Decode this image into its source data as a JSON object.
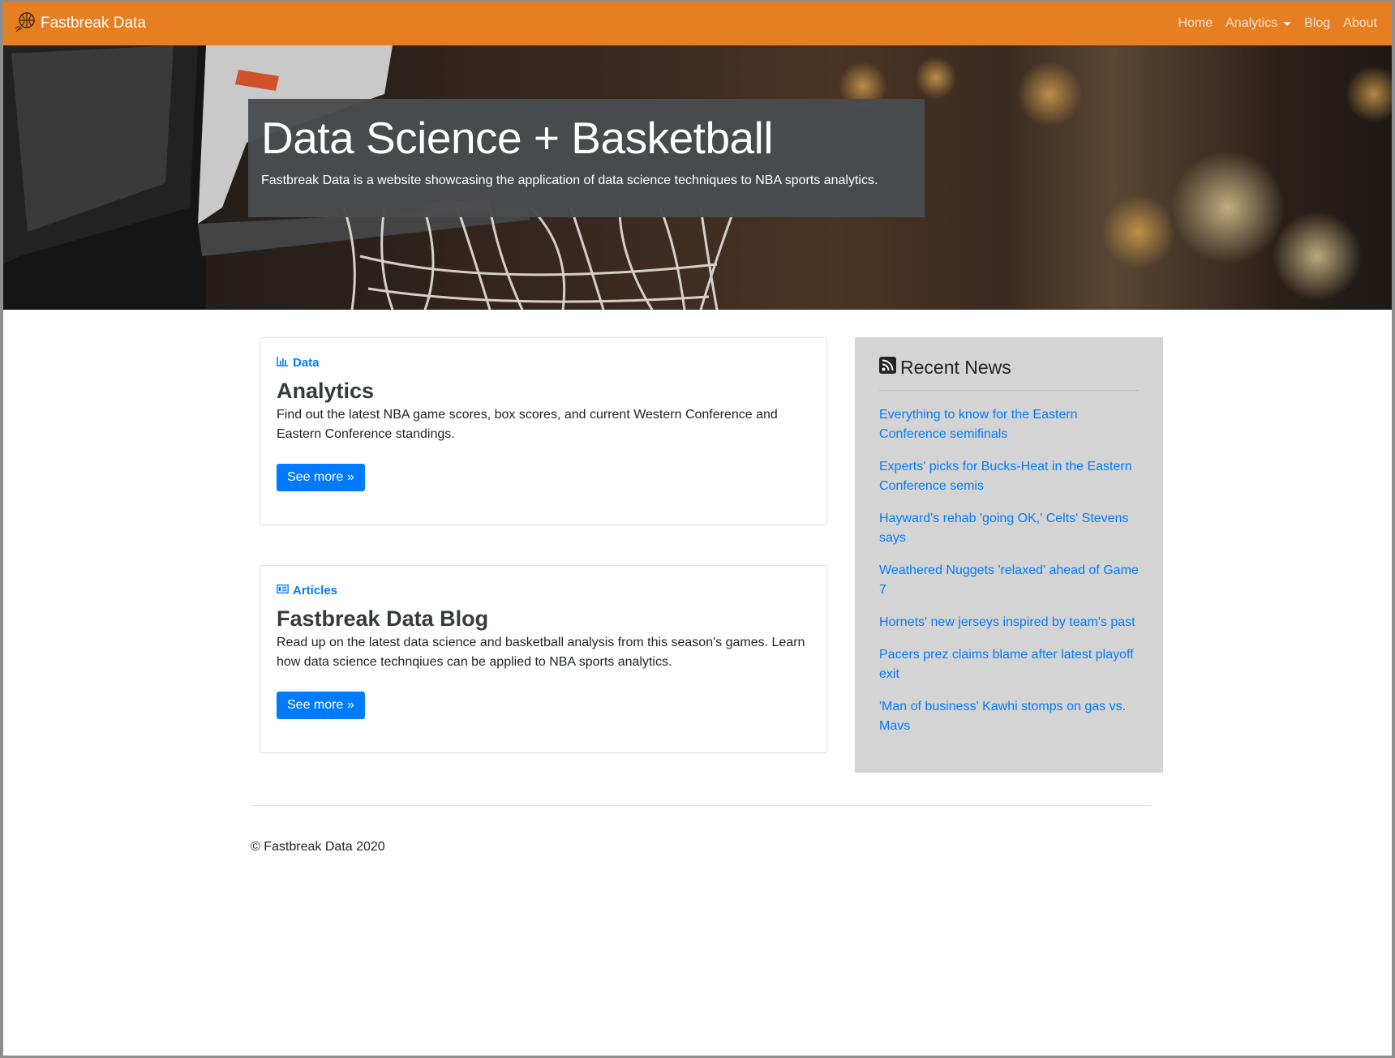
{
  "navbar": {
    "brand": "Fastbreak Data",
    "links": [
      "Home",
      "Analytics",
      "Blog",
      "About"
    ],
    "color": "#e67e22"
  },
  "hero": {
    "title": "Data Science + Basketball",
    "subtitle": "Fastbreak Data is a website showcasing the application of data science techniques to NBA sports analytics."
  },
  "cards": [
    {
      "category": "Data",
      "icon": "bar-chart-icon",
      "title": "Analytics",
      "text": "Find out the latest NBA game scores, box scores, and current Western Conference and Eastern Conference standings.",
      "button": "See more »"
    },
    {
      "category": "Articles",
      "icon": "newspaper-icon",
      "title": "Fastbreak Data Blog",
      "text": "Read up on the latest data science and basketball analysis from this season's games. Learn how data science technqiues can be applied to NBA sports analytics.",
      "button": "See more »"
    }
  ],
  "news": {
    "heading": "Recent News",
    "icon": "rss-icon",
    "items": [
      "Everything to know for the Eastern Conference semifinals",
      "Experts' picks for Bucks-Heat in the Eastern Conference semis",
      "Hayward's rehab 'going OK,' Celts' Stevens says",
      "Weathered Nuggets 'relaxed' ahead of Game 7",
      "Hornets' new jerseys inspired by team's past",
      "Pacers prez claims blame after latest playoff exit",
      "'Man of business' Kawhi stomps on gas vs. Mavs"
    ]
  },
  "footer": {
    "text": "© Fastbreak Data 2020"
  }
}
